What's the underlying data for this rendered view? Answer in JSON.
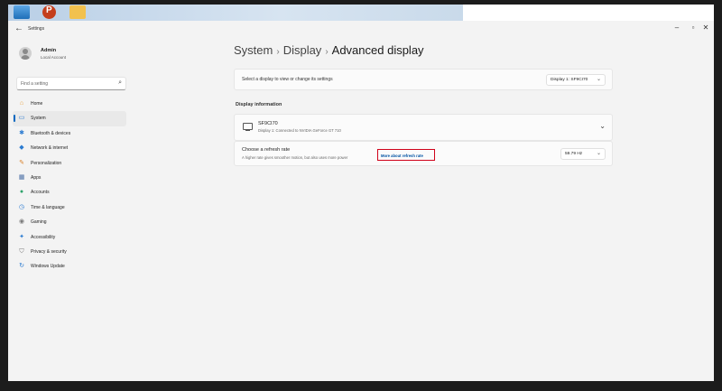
{
  "window": {
    "title": "Settings"
  },
  "profile": {
    "name": "Admin",
    "account": "Local Account"
  },
  "search": {
    "placeholder": "Find a setting"
  },
  "nav": [
    {
      "label": "Home",
      "icon": "home-icon",
      "color": "#e8a03c"
    },
    {
      "label": "System",
      "icon": "system-icon",
      "color": "#2b7bd1",
      "active": true
    },
    {
      "label": "Bluetooth & devices",
      "icon": "bluetooth-icon",
      "color": "#2b7bd1"
    },
    {
      "label": "Network & internet",
      "icon": "wifi-icon",
      "color": "#2b7bd1"
    },
    {
      "label": "Personalization",
      "icon": "brush-icon",
      "color": "#d9822b"
    },
    {
      "label": "Apps",
      "icon": "apps-icon",
      "color": "#4a6fa5"
    },
    {
      "label": "Accounts",
      "icon": "accounts-icon",
      "color": "#2ea36b"
    },
    {
      "label": "Time & language",
      "icon": "clock-icon",
      "color": "#2b7bd1"
    },
    {
      "label": "Gaming",
      "icon": "gaming-icon",
      "color": "#7a7a7a"
    },
    {
      "label": "Accessibility",
      "icon": "accessibility-icon",
      "color": "#2b7bd1"
    },
    {
      "label": "Privacy & security",
      "icon": "shield-icon",
      "color": "#7a7a7a"
    },
    {
      "label": "Windows Update",
      "icon": "update-icon",
      "color": "#2b7bd1"
    }
  ],
  "breadcrumb": {
    "part1": "System",
    "part2": "Display",
    "current": "Advanced display"
  },
  "select_display": {
    "label": "Select a display to view or change its settings",
    "value": "Display 1: SF9CI70"
  },
  "display_info": {
    "heading": "Display information",
    "monitor_name": "SF9CI70",
    "monitor_sub": "Display 1: Connected to NVIDIA GeForce GT 710"
  },
  "refresh": {
    "title": "Choose a refresh rate",
    "subtitle": "A higher rate gives smoother motion, but also uses more power",
    "link": "More about refresh rate",
    "value": "59.79 Hz"
  },
  "accent": "#0067c0",
  "highlight": "#d0021b"
}
